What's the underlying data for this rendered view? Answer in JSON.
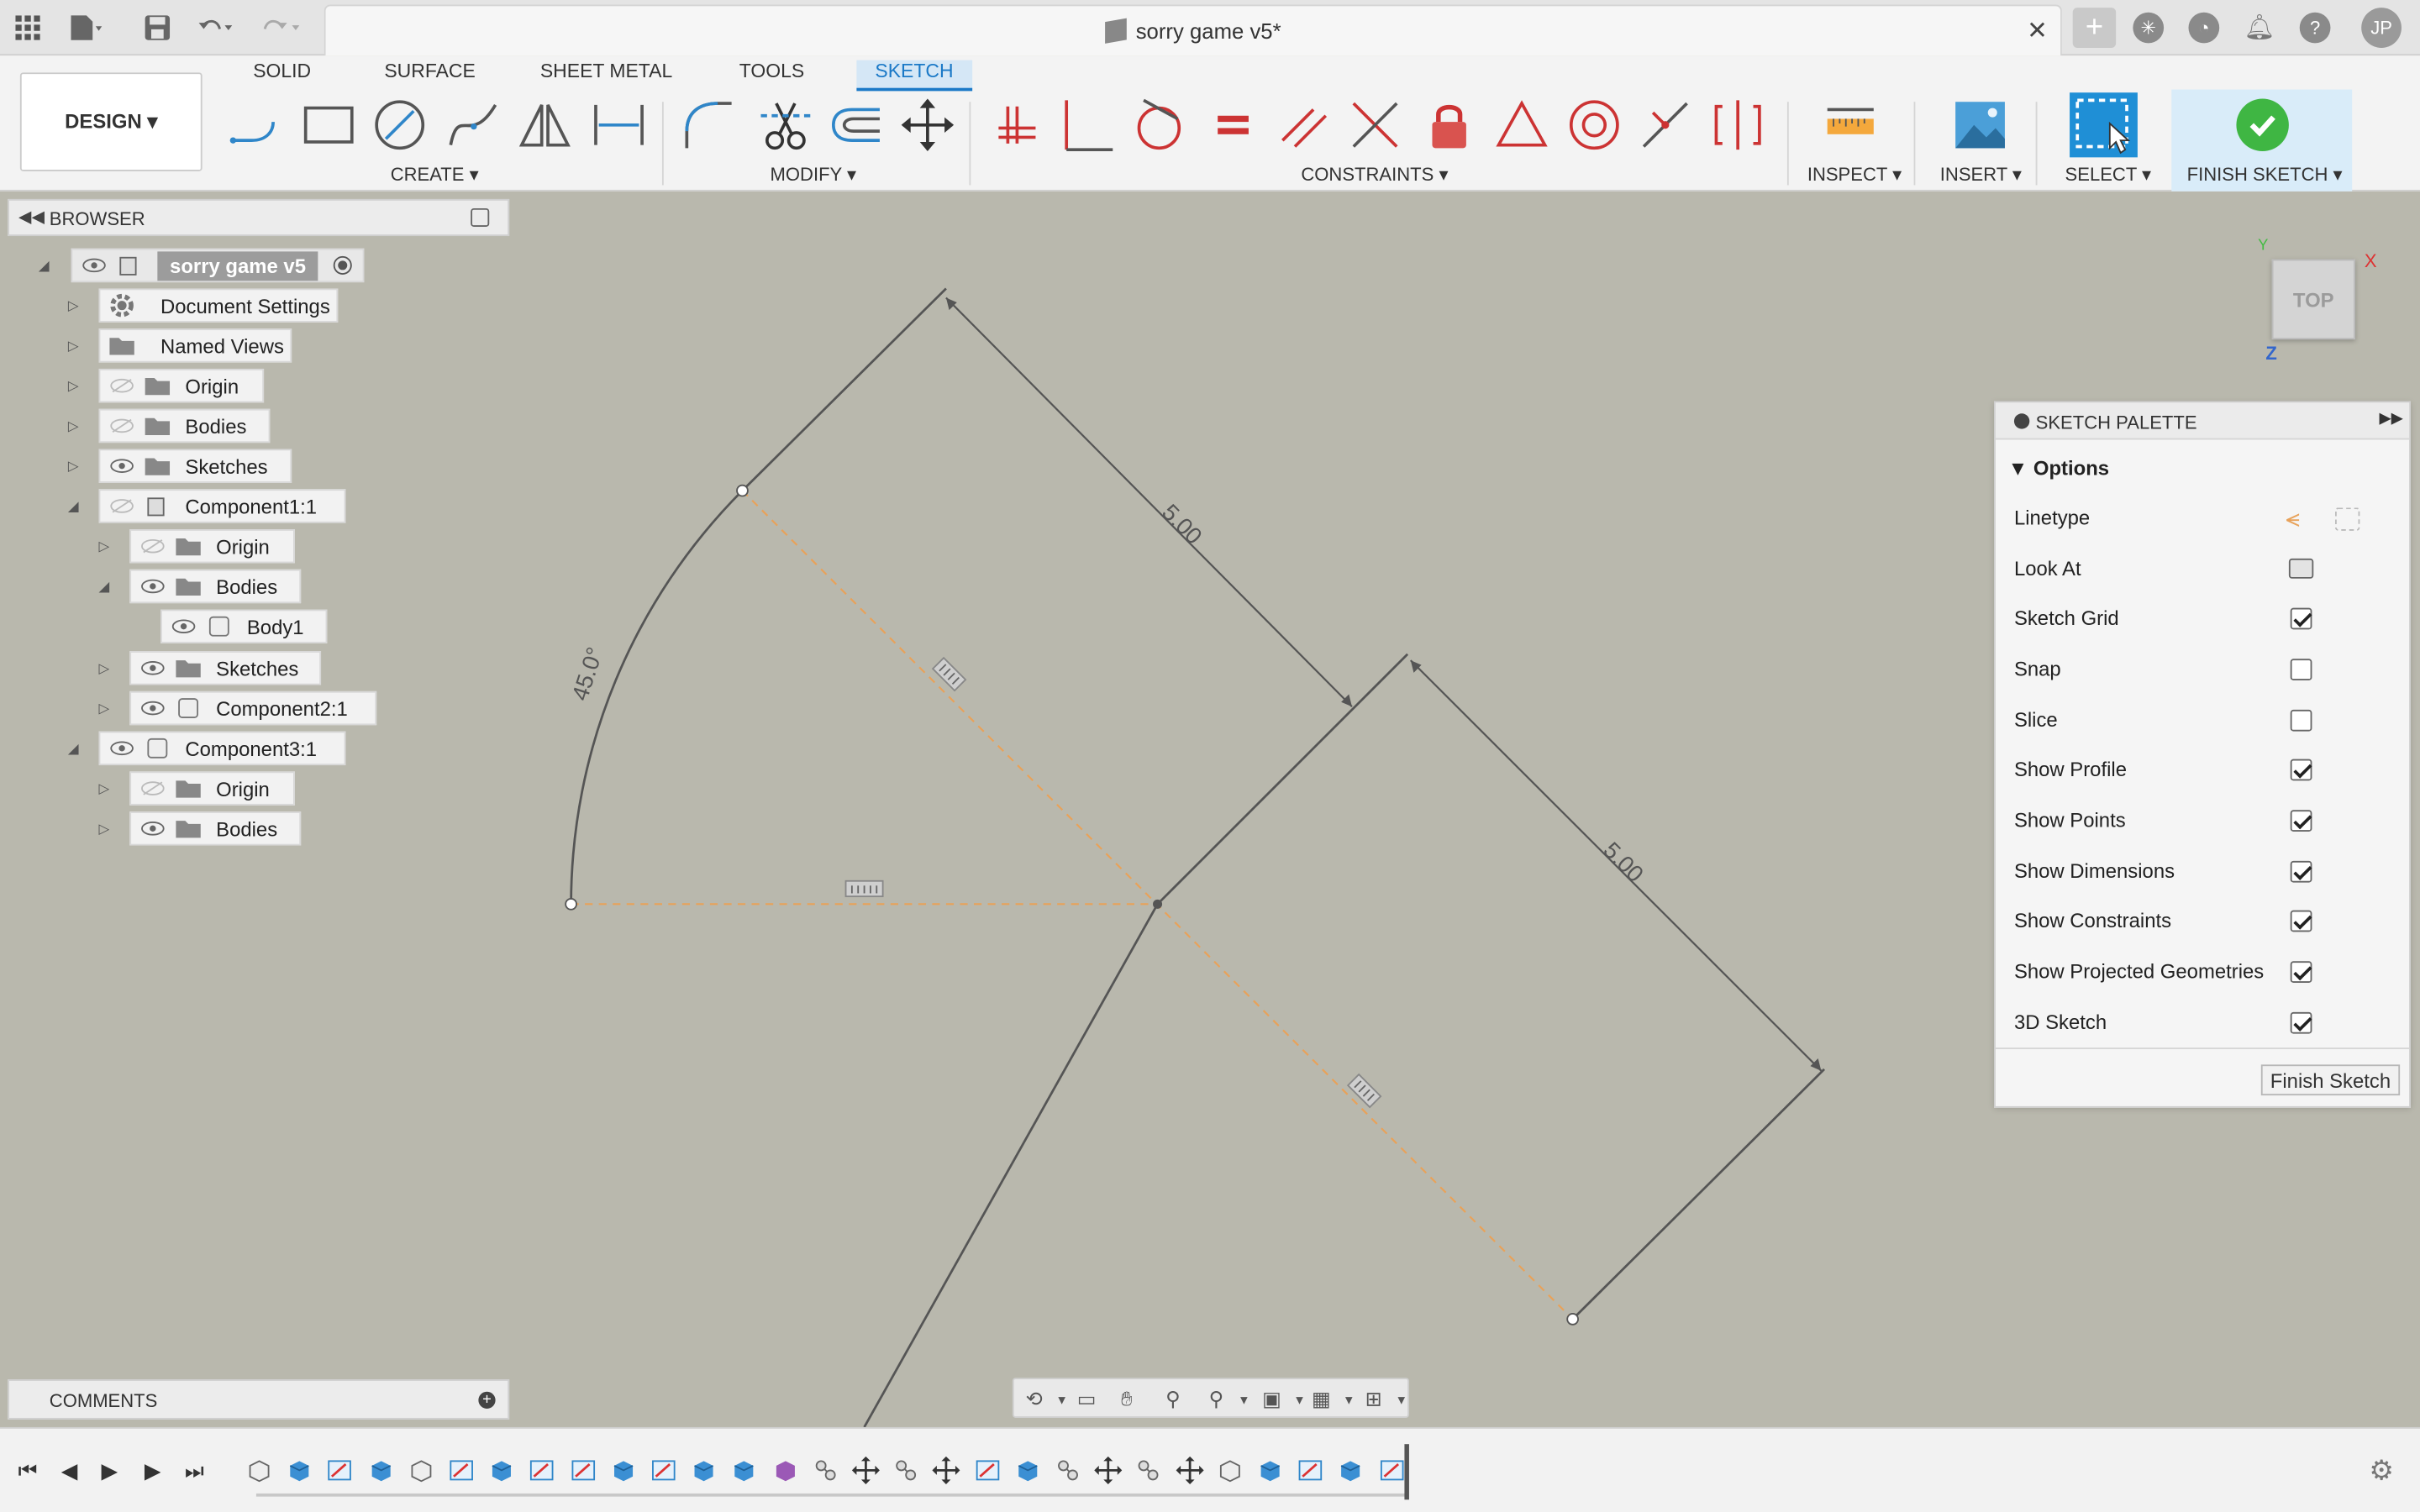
{
  "window": {
    "doc_title": "sorry game v5*",
    "avatar_initials": "JP"
  },
  "workspace_tabs": [
    "SOLID",
    "SURFACE",
    "SHEET METAL",
    "TOOLS",
    "SKETCH"
  ],
  "active_tab": "SKETCH",
  "design_button": "DESIGN ▾",
  "groups": {
    "create": "CREATE ▾",
    "modify": "MODIFY ▾",
    "constraints": "CONSTRAINTS ▾",
    "inspect": "INSPECT ▾",
    "insert": "INSERT ▾",
    "select": "SELECT ▾",
    "finish": "FINISH SKETCH ▾"
  },
  "browser": {
    "title": "BROWSER",
    "items": [
      {
        "label": "sorry game v5"
      },
      {
        "label": "Document Settings"
      },
      {
        "label": "Named Views"
      },
      {
        "label": "Origin"
      },
      {
        "label": "Bodies"
      },
      {
        "label": "Sketches"
      },
      {
        "label": "Component1:1"
      },
      {
        "label": "Origin"
      },
      {
        "label": "Bodies"
      },
      {
        "label": "Body1"
      },
      {
        "label": "Sketches"
      },
      {
        "label": "Component2:1"
      },
      {
        "label": "Component3:1"
      },
      {
        "label": "Origin"
      },
      {
        "label": "Bodies"
      }
    ]
  },
  "comments": {
    "title": "COMMENTS"
  },
  "viewcube": {
    "face": "TOP",
    "x": "X",
    "y": "Y",
    "z": "Z"
  },
  "sketch_palette": {
    "title": "SKETCH PALETTE",
    "section": "Options",
    "rows": [
      {
        "label": "Linetype"
      },
      {
        "label": "Look At"
      },
      {
        "label": "Sketch Grid",
        "checked": true
      },
      {
        "label": "Snap",
        "checked": false
      },
      {
        "label": "Slice",
        "checked": false
      },
      {
        "label": "Show Profile",
        "checked": true
      },
      {
        "label": "Show Points",
        "checked": true
      },
      {
        "label": "Show Dimensions",
        "checked": true
      },
      {
        "label": "Show Constraints",
        "checked": true
      },
      {
        "label": "Show Projected Geometries",
        "checked": true
      },
      {
        "label": "3D Sketch",
        "checked": true
      }
    ],
    "finish_button": "Finish Sketch"
  },
  "dimensions": {
    "angle": "45.0°",
    "length_top": "5.00",
    "length_right": "5.00"
  },
  "colors": {
    "accent": "#1b79c7",
    "canvas": "#b9b8ad",
    "construction": "#e8a25a",
    "finish_green": "#3fb643"
  }
}
